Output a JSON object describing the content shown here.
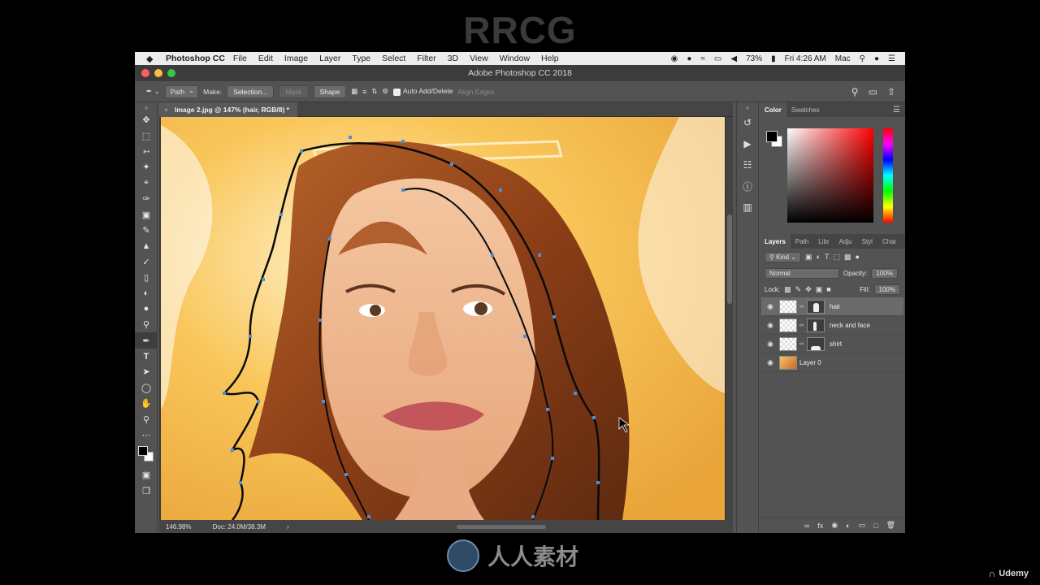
{
  "watermark": {
    "top": "RRCG",
    "bottom": "人人素材",
    "udemy": "Udemy"
  },
  "menubar": {
    "app": "Photoshop CC",
    "items": [
      "File",
      "Edit",
      "Image",
      "Layer",
      "Type",
      "Select",
      "Filter",
      "3D",
      "View",
      "Window",
      "Help"
    ],
    "battery": "73%",
    "clock": "Fri 4:26 AM",
    "user": "Mac"
  },
  "titlebar": {
    "title": "Adobe Photoshop CC 2018"
  },
  "options": {
    "mode": "Path",
    "make_label": "Make:",
    "selection_btn": "Selection...",
    "mask_btn": "Mask",
    "shape_btn": "Shape",
    "auto_add_delete": "Auto Add/Delete",
    "align_edges": "Align Edges"
  },
  "document": {
    "tab": "Image 2.jpg @ 147% (hair, RGB/8) *",
    "zoom": "146.98%",
    "docsize": "Doc: 24.0M/38.3M"
  },
  "color_panel": {
    "tabs": [
      "Color",
      "Swatches"
    ],
    "fg": "#000000",
    "bg": "#ffffff"
  },
  "layers_panel": {
    "tabs": [
      "Layers",
      "Path",
      "Libr",
      "Adju",
      "Styl",
      "Char"
    ],
    "filter_kind": "Kind",
    "blend_mode": "Normal",
    "opacity_label": "Opacity:",
    "opacity": "100%",
    "lock_label": "Lock:",
    "fill_label": "Fill:",
    "fill": "100%",
    "layers": [
      {
        "name": "hair",
        "selected": true
      },
      {
        "name": "neck and face",
        "selected": false
      },
      {
        "name": "shirt",
        "selected": false
      },
      {
        "name": "Layer 0",
        "selected": false
      }
    ]
  },
  "colors": {
    "path_anchor": "#4a8fe0",
    "path_stroke": "#0a0a0a",
    "panel_bg": "#535353"
  }
}
